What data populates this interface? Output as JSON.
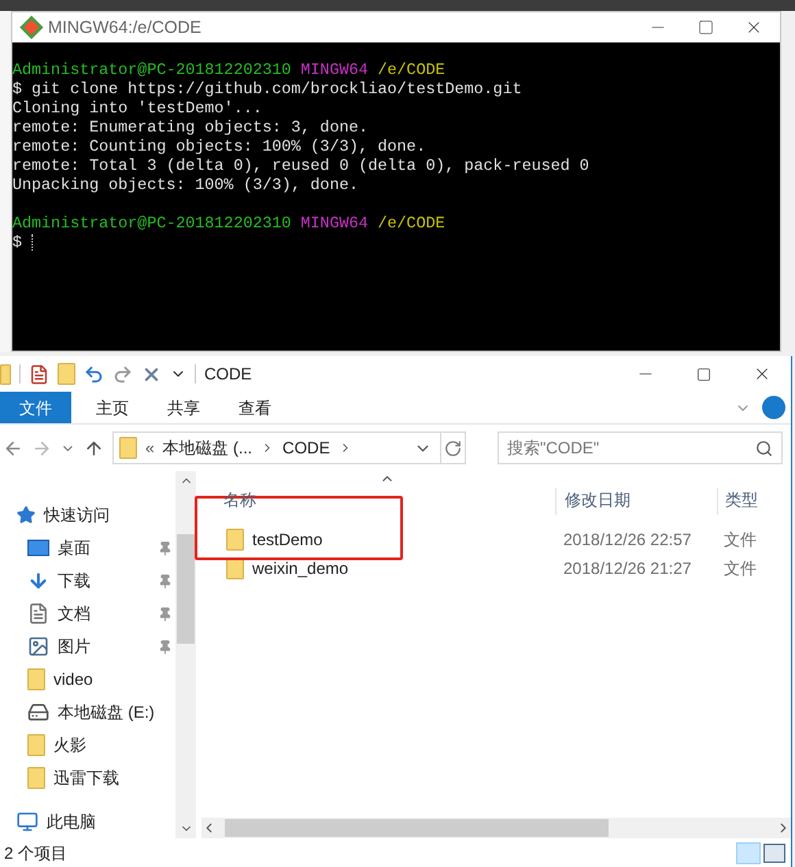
{
  "terminal": {
    "title": "MINGW64:/e/CODE",
    "lines": [
      {
        "kind": "text",
        "segments": [
          {
            "text": "Administrator@PC-201812202310",
            "color": "#25bc24"
          },
          {
            "text": "MINGW64",
            "color": "#c930c7"
          },
          {
            "text": "/e/CODE",
            "color": "#c7c400"
          }
        ]
      },
      {
        "kind": "text",
        "segments": [
          {
            "text": "$ git clone https://github.com/brockliao/testDemo.git",
            "color": "#e0e0e0"
          }
        ]
      },
      {
        "kind": "text",
        "segments": [
          {
            "text": "Cloning into 'testDemo'...",
            "color": "#e0e0e0"
          }
        ]
      },
      {
        "kind": "text",
        "segments": [
          {
            "text": "remote: Enumerating objects: 3, done.",
            "color": "#e0e0e0"
          }
        ]
      },
      {
        "kind": "text",
        "segments": [
          {
            "text": "remote: Counting objects: 100% (3/3), done.",
            "color": "#e0e0e0"
          }
        ]
      },
      {
        "kind": "text",
        "segments": [
          {
            "text": "remote: Total 3 (delta 0), reused 0 (delta 0), pack-reused 0",
            "color": "#e0e0e0"
          }
        ]
      },
      {
        "kind": "text",
        "segments": [
          {
            "text": "Unpacking objects: 100% (3/3), done.",
            "color": "#e0e0e0"
          }
        ]
      },
      {
        "kind": "blank"
      },
      {
        "kind": "text",
        "segments": [
          {
            "text": "Administrator@PC-201812202310",
            "color": "#25bc24"
          },
          {
            "text": "MINGW64",
            "color": "#c930c7"
          },
          {
            "text": "/e/CODE",
            "color": "#c7c400"
          }
        ]
      },
      {
        "kind": "prompt",
        "segments": [
          {
            "text": "$",
            "color": "#e0e0e0"
          }
        ]
      }
    ]
  },
  "explorer": {
    "title": "CODE",
    "ribbon_tabs": [
      {
        "label": "文件",
        "kind": "file",
        "selected": false
      },
      {
        "label": "主页",
        "kind": "tab",
        "selected": false
      },
      {
        "label": "共享",
        "kind": "tab",
        "selected": false
      },
      {
        "label": "查看",
        "kind": "tab",
        "selected": false
      }
    ],
    "address": {
      "overflow": "«",
      "crumbs": [
        "本地磁盘 (...",
        "CODE"
      ]
    },
    "search": {
      "placeholder": "搜索\"CODE\""
    },
    "sidebar": [
      {
        "label": "快速访问",
        "kind": "star",
        "pinned": false
      },
      {
        "label": "桌面",
        "kind": "desktop",
        "pinned": true
      },
      {
        "label": "下载",
        "kind": "download",
        "pinned": true
      },
      {
        "label": "文档",
        "kind": "document",
        "pinned": true
      },
      {
        "label": "图片",
        "kind": "picture",
        "pinned": true
      },
      {
        "label": "video",
        "kind": "folder",
        "pinned": false
      },
      {
        "label": "本地磁盘 (E:)",
        "kind": "drive",
        "pinned": false
      },
      {
        "label": "火影",
        "kind": "folder",
        "pinned": false
      },
      {
        "label": "迅雷下载",
        "kind": "folder",
        "pinned": false
      },
      {
        "label": "此电脑",
        "kind": "computer",
        "pinned": false
      }
    ],
    "columns": [
      "名称",
      "修改日期",
      "类型"
    ],
    "rows": [
      {
        "name": "testDemo",
        "date": "2018/12/26 22:57",
        "type": "文件",
        "highlighted": true
      },
      {
        "name": "weixin_demo",
        "date": "2018/12/26 21:27",
        "type": "文件",
        "highlighted": false
      }
    ],
    "status": "2 个项目"
  }
}
